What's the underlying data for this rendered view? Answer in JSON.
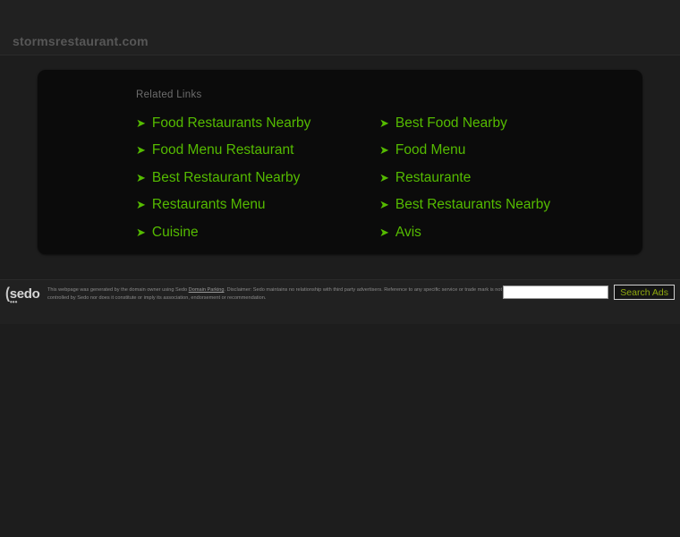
{
  "header": {
    "domain": "stormsrestaurant.com"
  },
  "main": {
    "panel_heading": "Related Links",
    "links": [
      {
        "arrow": "arrow-right-icon",
        "label": "Food Restaurants Nearby"
      },
      {
        "arrow": "arrow-right-icon",
        "label": "Best Food Nearby"
      },
      {
        "arrow": "arrow-right-icon",
        "label": "Food Menu Restaurant"
      },
      {
        "arrow": "arrow-right-icon",
        "label": "Food Menu"
      },
      {
        "arrow": "arrow-right-icon",
        "label": "Best Restaurant Nearby"
      },
      {
        "arrow": "arrow-right-icon",
        "label": "Restaurante"
      },
      {
        "arrow": "arrow-right-icon",
        "label": "Restaurants Menu"
      },
      {
        "arrow": "arrow-right-icon",
        "label": "Best Restaurants Nearby"
      },
      {
        "arrow": "arrow-right-icon",
        "label": "Cuisine"
      },
      {
        "arrow": "arrow-right-icon",
        "label": "Avis"
      }
    ]
  },
  "footer": {
    "logo_text": "sedo",
    "logo_paren": "(",
    "logo_dots": "•••",
    "disclaimer_part1": "This webpage was generated by the domain owner using Sedo ",
    "disclaimer_link": "Domain Parking",
    "disclaimer_part2": ". Disclaimer: Sedo maintains no relationship with third party advertisers. Reference to any specific service or trade mark is not controlled by Sedo nor does it constitute or imply its association, endorsement or recommendation.",
    "search_placeholder": "",
    "search_value": "",
    "search_button_label": "Search Ads"
  },
  "colors": {
    "link_green": "#55bb00",
    "page_bg": "#1d1d1d",
    "panel_bg": "#0b0b0b",
    "bar_bg": "#212121",
    "button_text": "#8fa80f"
  }
}
